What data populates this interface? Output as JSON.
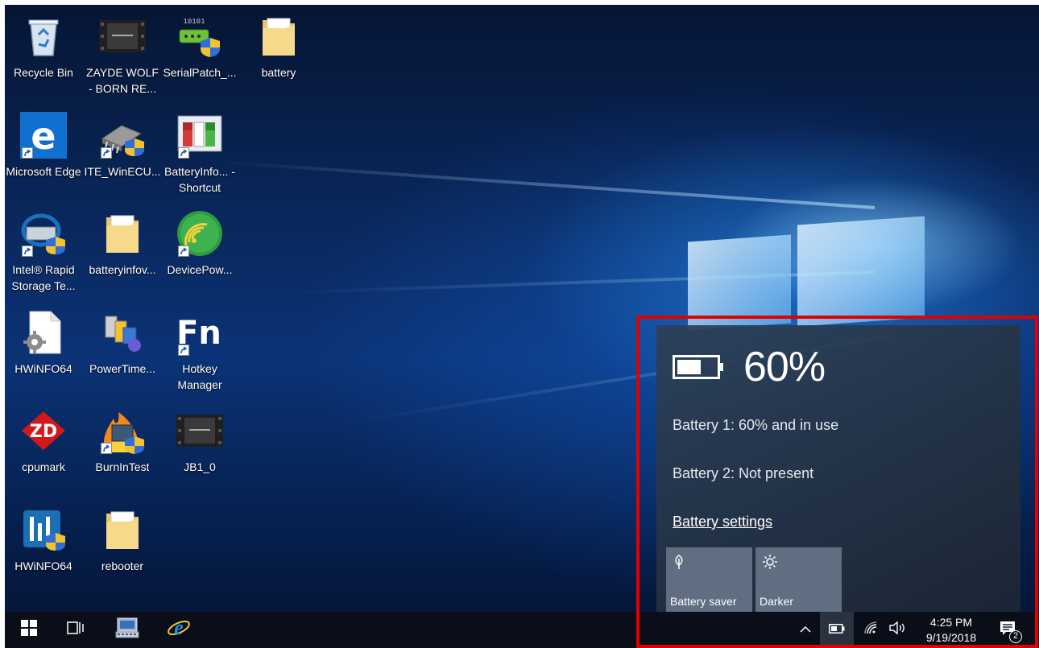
{
  "desktop": {
    "icons": [
      {
        "label": "Recycle Bin",
        "icon": "recycle-bin-icon"
      },
      {
        "label": "ZAYDE WOLF - BORN RE...",
        "icon": "video-file-icon"
      },
      {
        "label": "SerialPatch_...",
        "icon": "serial-patch-icon"
      },
      {
        "label": "battery",
        "icon": "folder-icon"
      },
      {
        "label": "Microsoft Edge",
        "icon": "edge-icon"
      },
      {
        "label": "ITE_WinECU...",
        "icon": "chip-icon"
      },
      {
        "label": "BatteryInfo... - Shortcut",
        "icon": "battery-info-icon"
      },
      {
        "label": "Intel® Rapid Storage Te...",
        "icon": "intel-rst-icon"
      },
      {
        "label": "batteryinfov...",
        "icon": "folder-icon"
      },
      {
        "label": "DevicePow...",
        "icon": "device-power-icon"
      },
      {
        "label": "HWiNFO64",
        "icon": "settings-file-icon"
      },
      {
        "label": "PowerTime...",
        "icon": "power-time-icon"
      },
      {
        "label": "Hotkey Manager",
        "icon": "fn-key-icon"
      },
      {
        "label": "cpumark",
        "icon": "zd-icon"
      },
      {
        "label": "BurnInTest",
        "icon": "burnintest-icon"
      },
      {
        "label": "JB1_0",
        "icon": "video-file-icon"
      },
      {
        "label": "HWiNFO64",
        "icon": "hwinfo-icon"
      },
      {
        "label": "rebooter",
        "icon": "folder-icon"
      }
    ]
  },
  "battery_flyout": {
    "percent_text": "60%",
    "battery_level": 0.6,
    "battery1_text": "Battery 1: 60% and in use",
    "battery2_text": "Battery 2: Not present",
    "settings_link": "Battery settings",
    "tiles": [
      {
        "label": "Battery saver",
        "icon": "leaf-icon"
      },
      {
        "label": "Darker",
        "icon": "brightness-icon"
      }
    ]
  },
  "taskbar": {
    "pinned": [
      {
        "icon": "windows-start-icon"
      },
      {
        "icon": "task-view-icon"
      },
      {
        "icon": "on-screen-keyboard-icon"
      },
      {
        "icon": "internet-explorer-icon"
      }
    ],
    "tray": [
      {
        "icon": "chevron-up-icon"
      },
      {
        "icon": "battery-icon"
      },
      {
        "icon": "wifi-icon"
      },
      {
        "icon": "volume-icon"
      }
    ],
    "clock_time": "4:25 PM",
    "clock_date": "9/19/2018",
    "notification_count": "2"
  },
  "colors": {
    "highlight_border": "#e00000",
    "flyout_tile": "#5f6e80",
    "taskbar": "#0a0e18"
  }
}
